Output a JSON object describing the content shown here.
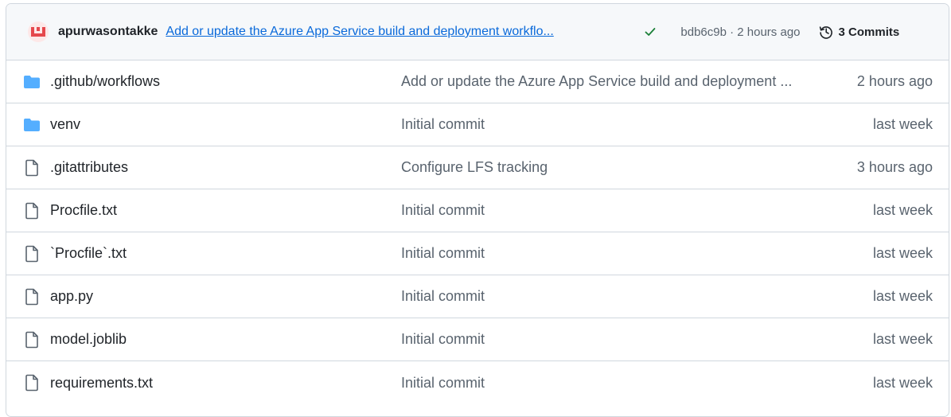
{
  "latest_commit": {
    "avatar_icon": "user-avatar",
    "author": "apurwasontakke",
    "message": "Add or update the Azure App Service build and deployment workflo...",
    "status_icon": "check-icon",
    "status_color": "#1a7f37",
    "meta": "bdb6c9b · 2 hours ago",
    "commits_icon": "history-icon",
    "commits_label": "3 Commits"
  },
  "files": [
    {
      "type": "folder",
      "icon": "folder-icon",
      "name": ".github/workflows",
      "commit": "Add or update the Azure App Service build and deployment ...",
      "time": "2 hours ago"
    },
    {
      "type": "folder",
      "icon": "folder-icon",
      "name": "venv",
      "commit": "Initial commit",
      "time": "last week"
    },
    {
      "type": "file",
      "icon": "file-icon",
      "name": ".gitattributes",
      "commit": "Configure LFS tracking",
      "time": "3 hours ago"
    },
    {
      "type": "file",
      "icon": "file-icon",
      "name": "Procfile.txt",
      "commit": "Initial commit",
      "time": "last week"
    },
    {
      "type": "file",
      "icon": "file-icon",
      "name": "`Procfile`.txt",
      "commit": "Initial commit",
      "time": "last week"
    },
    {
      "type": "file",
      "icon": "file-icon",
      "name": "app.py",
      "commit": "Initial commit",
      "time": "last week"
    },
    {
      "type": "file",
      "icon": "file-icon",
      "name": "model.joblib",
      "commit": "Initial commit",
      "time": "last week"
    },
    {
      "type": "file",
      "icon": "file-icon",
      "name": "requirements.txt",
      "commit": "Initial commit",
      "time": "last week"
    }
  ],
  "colors": {
    "folder": "#54aeff",
    "file_icon": "#59636e",
    "link": "#0969da"
  }
}
